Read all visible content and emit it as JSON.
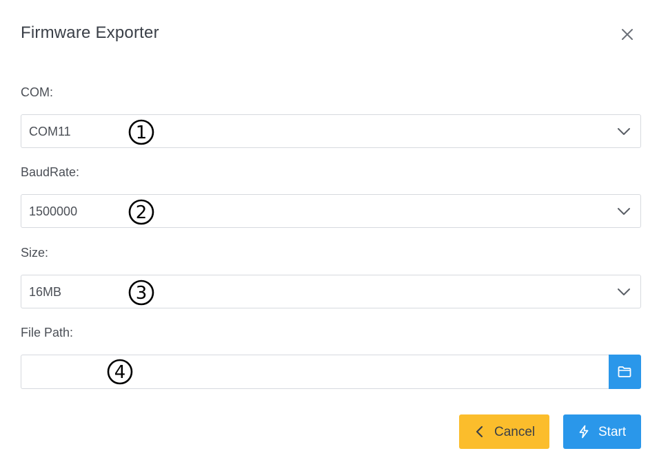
{
  "dialog": {
    "title": "Firmware Exporter",
    "close_icon": "close-icon"
  },
  "fields": {
    "com": {
      "label": "COM:",
      "value": "COM11",
      "marker": "①"
    },
    "baudrate": {
      "label": "BaudRate:",
      "value": "1500000",
      "marker": "②"
    },
    "size": {
      "label": "Size:",
      "value": "16MB",
      "marker": "③"
    },
    "file_path": {
      "label": "File Path:",
      "value": "",
      "marker": "④",
      "button_icon": "folder-icon"
    }
  },
  "buttons": {
    "cancel": {
      "label": "Cancel",
      "icon": "chevron-left-icon"
    },
    "start": {
      "label": "Start",
      "icon": "lightning-icon"
    }
  },
  "colors": {
    "primary": "#2a97ea",
    "warning": "#fbbd2c",
    "border": "#d6d9de",
    "text": "#4b4f56"
  }
}
